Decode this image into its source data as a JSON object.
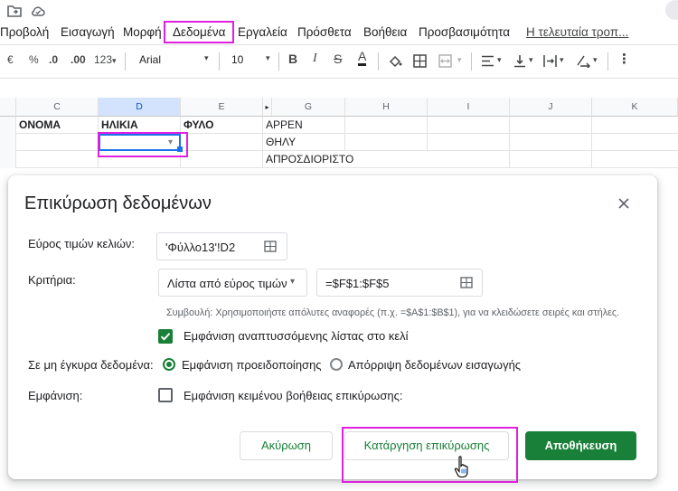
{
  "menu": {
    "items": [
      "Προβολή",
      "Εισαγωγή",
      "Μορφή",
      "Δεδομένα",
      "Εργαλεία",
      "Πρόσθετα",
      "Βοήθεια",
      "Προσβασιμότητα"
    ],
    "last_edit": "Η τελευταία τροπ..."
  },
  "toolbar": {
    "currency": "€",
    "percent": "%",
    "dec_less": ".0",
    "dec_more": ".00",
    "number_format": "123",
    "font": "Arial",
    "font_size": "10",
    "more": "⋮"
  },
  "sheet": {
    "columns": [
      "C",
      "D",
      "E",
      "G",
      "H",
      "I",
      "J",
      "K"
    ],
    "row1": {
      "c": "ΟΝΟΜΑ",
      "d": "ΗΛΙΚΙΑ",
      "e": "ΦΥΛΟ",
      "g": "ΑΡΡΕΝ"
    },
    "row2": {
      "g": "ΘΗΛΥ"
    },
    "row3": {
      "g": "ΑΠΡΟΣΔΙΟΡΙΣΤΟ"
    }
  },
  "dialog": {
    "title": "Επικύρωση δεδομένων",
    "range_label": "Εύρος τιμών κελιών:",
    "range_value": "'Φύλλο13'!D2",
    "criteria_label": "Κριτήρια:",
    "criteria_type": "Λίστα από εύρος τιμών",
    "criteria_range": "=$F$1:$F$5",
    "hint": "Συμβουλή: Χρησιμοποιήστε απόλυτες αναφορές (π.χ. =$A$1:$B$1), για να κλειδώσετε σειρές και στήλες.",
    "show_dropdown": "Εμφάνιση αναπτυσσόμενης λίστας στο κελί",
    "invalid_label": "Σε μη έγκυρα δεδομένα:",
    "invalid_warn": "Εμφάνιση προειδοποίησης",
    "invalid_reject": "Απόρριψη δεδομένων εισαγωγής",
    "appearance_label": "Εμφάνιση:",
    "help_text": "Εμφάνιση κειμένου βοήθειας επικύρωσης:",
    "cancel": "Ακύρωση",
    "remove": "Κατάργηση επικύρωσης",
    "save": "Αποθήκευση"
  },
  "colors": {
    "accent": "#188038",
    "highlight": "#e020e0",
    "selection": "#1a73e8"
  }
}
